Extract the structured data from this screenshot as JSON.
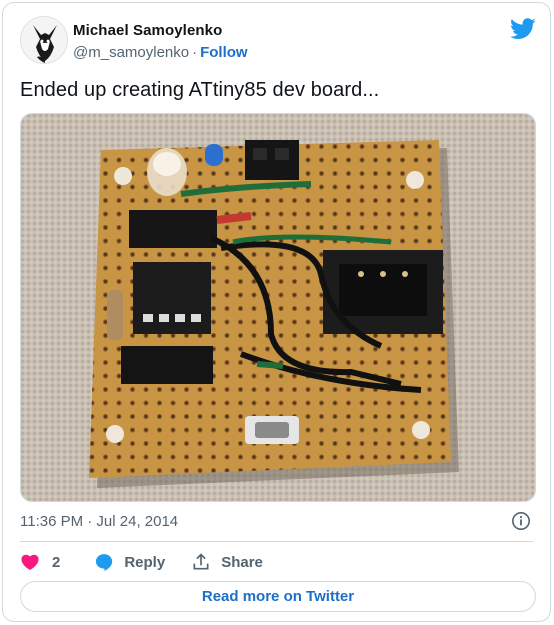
{
  "author": {
    "name": "Michael Samoylenko",
    "handle": "@m_samoylenko",
    "separator": "·",
    "follow_label": "Follow"
  },
  "tweet": {
    "text": "Ended up creating ATtiny85 dev board...",
    "timestamp": "11:36 PM · Jul 24, 2014"
  },
  "media": {
    "description": "photo-perfboard-attiny85-dev-board"
  },
  "actions": {
    "like_count": "2",
    "reply_label": "Reply",
    "share_label": "Share"
  },
  "footer": {
    "read_more_label": "Read more on Twitter"
  },
  "icons": {
    "brand": "twitter-bird-icon",
    "info": "info-icon",
    "like": "heart-icon",
    "reply": "speech-bubble-icon",
    "share": "share-upload-icon"
  },
  "colors": {
    "brand_blue": "#1d9bf0",
    "link_blue": "#1d6fc7",
    "like_pink": "#f91880",
    "muted": "#536471",
    "border": "#cfd9de"
  }
}
